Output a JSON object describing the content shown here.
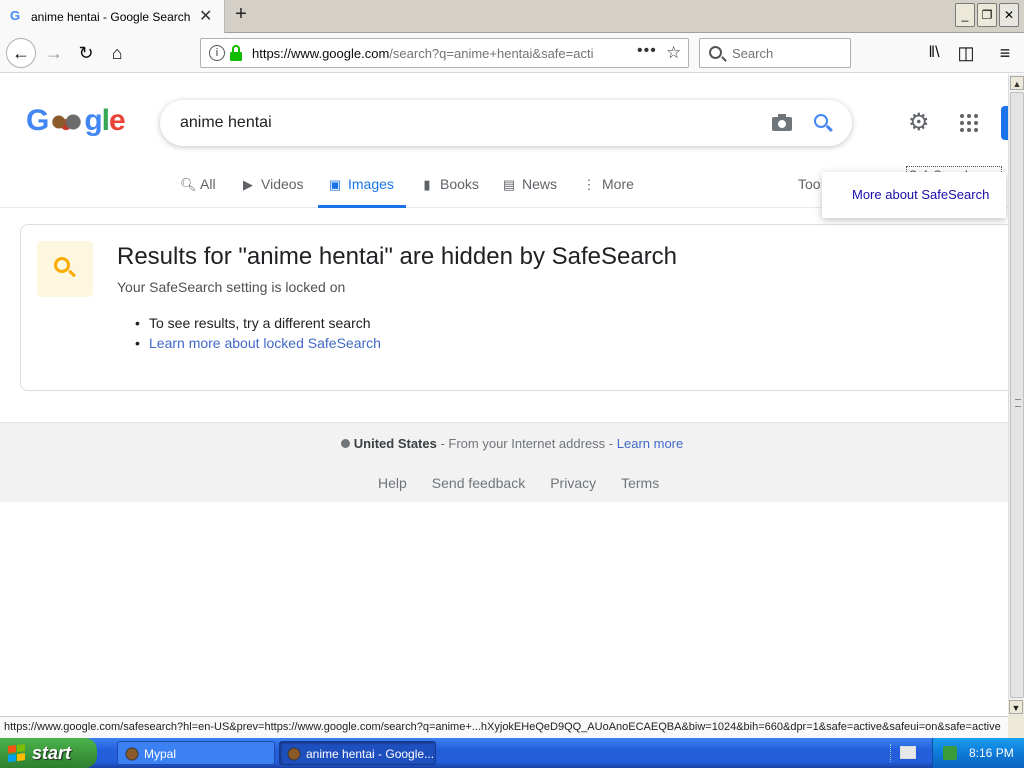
{
  "browser": {
    "tab_title": "anime hentai - Google Search",
    "tab_favicon": "G",
    "url_host": "https://www.google.com",
    "url_path": "/search?q=anime+hentai&safe=acti",
    "search_placeholder": "Search",
    "status_url": "https://www.google.com/safesearch?hl=en-US&prev=https://www.google.com/search?q=anime+...hXyjokEHeQeD9QQ_AUoAnoECAEQBA&biw=1024&bih=660&dpr=1&safe=active&safeui=on&safe=active"
  },
  "google": {
    "logo": {
      "g1": "G",
      "g2": "g",
      "l": "l",
      "e": "e"
    },
    "query": "anime hentai",
    "tabs": [
      {
        "label": "All",
        "icon": "search-icon"
      },
      {
        "label": "Videos",
        "icon": "play-icon"
      },
      {
        "label": "Images",
        "icon": "image-icon",
        "active": true
      },
      {
        "label": "Books",
        "icon": "book-icon"
      },
      {
        "label": "News",
        "icon": "news-icon"
      },
      {
        "label": "More",
        "icon": "more-vert-icon"
      },
      {
        "label": "Too"
      }
    ],
    "safesearch_label": "SafeSearch",
    "popup_link": "More about SafeSearch",
    "card": {
      "headline": "Results for \"anime hentai\" are hidden by SafeSearch",
      "subtext": "Your SafeSearch setting is locked on",
      "bullet1": "To see results, try a different search",
      "bullet2": "Learn more about locked SafeSearch"
    },
    "footer": {
      "location": "United States",
      "location_sep": " - From your Internet address - ",
      "learn_more": "Learn more",
      "links": [
        "Help",
        "Send feedback",
        "Privacy",
        "Terms"
      ]
    }
  },
  "taskbar": {
    "start_label": "start",
    "items": [
      {
        "label": "Mypal"
      },
      {
        "label": "anime hentai - Google..."
      }
    ],
    "clock": "8:16 PM"
  },
  "colors": {
    "accent_blue": "#1a73e8",
    "link": "#1a0dab",
    "lock_green": "#12bc00",
    "xp_start_green": "#3c9a3c",
    "xp_taskbar_blue": "#245edb"
  }
}
